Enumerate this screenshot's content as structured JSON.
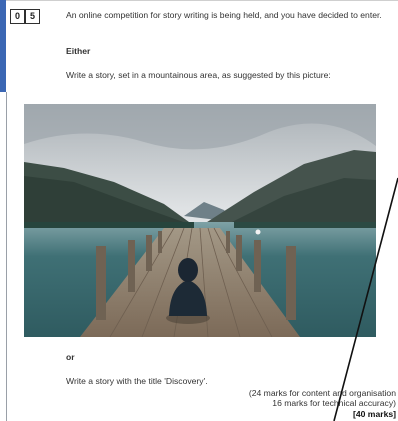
{
  "question": {
    "number_digits": [
      "0",
      "5"
    ],
    "intro": "An online competition for story writing is being held, and you have decided to enter.",
    "either_label": "Either",
    "instruction": "Write a story, set in a mountainous area, as suggested by this picture:",
    "or_label": "or",
    "alternative": "Write a story with the title 'Discovery'.",
    "marks_line1": "(24 marks for content and organisation",
    "marks_line2": "16 marks for technical accuracy)",
    "marks_total": "[40 marks]"
  },
  "colors": {
    "accent_bar": "#3b67b4",
    "sky": "#d9dde0",
    "water": "#3e6f73",
    "pier": "#8f7f6d"
  }
}
